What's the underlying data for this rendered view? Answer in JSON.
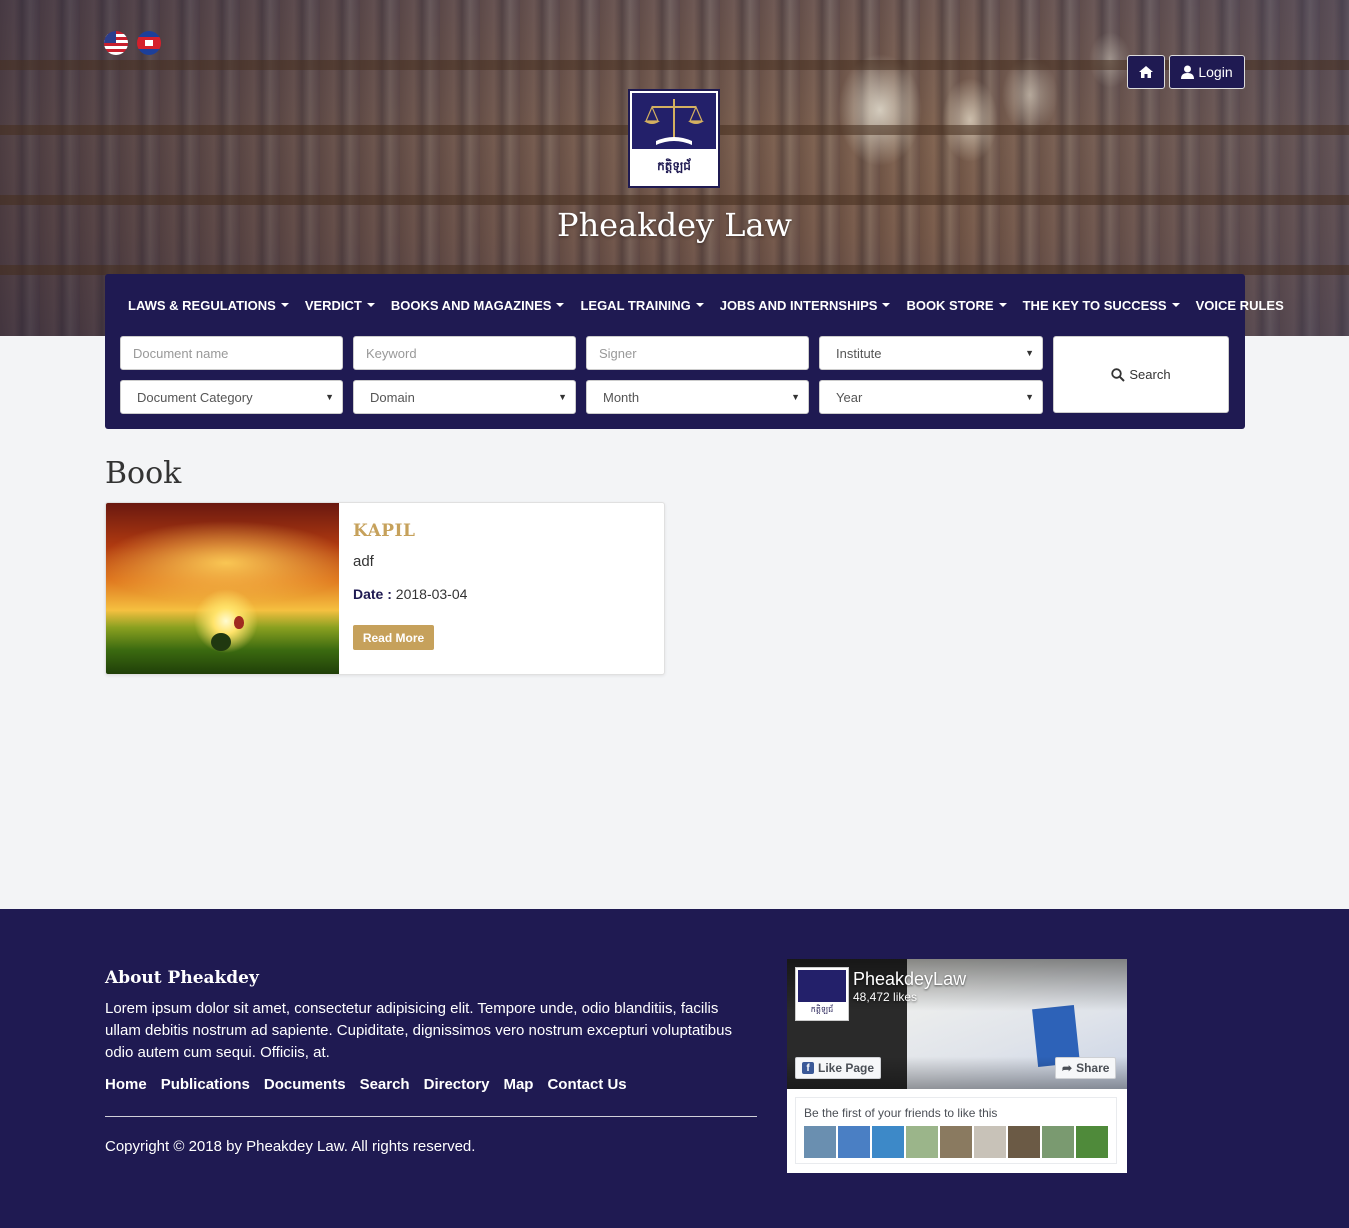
{
  "header": {
    "site_title": "Pheakdey Law",
    "logo_text": "កត្តិឡជ័",
    "languages": [
      "us-flag-icon",
      "khmer-flag-icon"
    ],
    "home_icon": "home-icon",
    "login_label": "Login",
    "login_icon": "user-icon"
  },
  "nav": {
    "items": [
      {
        "label": "LAWS & REGULATIONS",
        "dropdown": true
      },
      {
        "label": "VERDICT",
        "dropdown": true
      },
      {
        "label": "BOOKS AND MAGAZINES",
        "dropdown": true
      },
      {
        "label": "LEGAL TRAINING",
        "dropdown": true
      },
      {
        "label": "JOBS AND INTERNSHIPS",
        "dropdown": true
      },
      {
        "label": "BOOK STORE",
        "dropdown": true
      },
      {
        "label": "THE KEY TO SUCCESS",
        "dropdown": true
      },
      {
        "label": "VOICE RULES",
        "dropdown": false
      }
    ]
  },
  "search": {
    "document_name_placeholder": "Document name",
    "keyword_placeholder": "Keyword",
    "signer_placeholder": "Signer",
    "institute_value": "Institute",
    "document_category_value": "Document Category",
    "domain_value": "Domain",
    "month_value": "Month",
    "year_value": "Year",
    "button_label": "Search"
  },
  "main": {
    "section_title": "Book",
    "cards": [
      {
        "title": "KAPIL",
        "description": "adf",
        "date_label": "Date :",
        "date_value": "2018-03-04",
        "read_more": "Read More"
      }
    ]
  },
  "footer": {
    "about_title": "About Pheakdey",
    "about_text": "Lorem ipsum dolor sit amet, consectetur adipisicing elit. Tempore unde, odio blanditiis, facilis ullam debitis nostrum ad sapiente. Cupiditate, dignissimos vero nostrum excepturi voluptatibus odio autem cum sequi. Officiis, at.",
    "links": [
      "Home",
      "Publications",
      "Documents",
      "Search",
      "Directory",
      "Map",
      "Contact Us"
    ],
    "copyright": "Copyright © 2018 by Pheakdey Law. All rights reserved."
  },
  "facebook": {
    "page_name": "PheakdeyLaw",
    "likes": "48,472 likes",
    "like_button": "Like Page",
    "share_button": "Share",
    "friends_text": "Be the first of your friends to like this",
    "avatar_text": "កត្តិឡជ័",
    "face_colors": [
      "#6a8fb0",
      "#4a7fc4",
      "#3d89c8",
      "#9bb58a",
      "#8a7a60",
      "#c8c2b8",
      "#6b5a45",
      "#7a9a70",
      "#4f8a3a"
    ]
  },
  "colors": {
    "navy": "#1f1a52",
    "gold": "#c6a15b",
    "background": "#f3f4f6"
  }
}
